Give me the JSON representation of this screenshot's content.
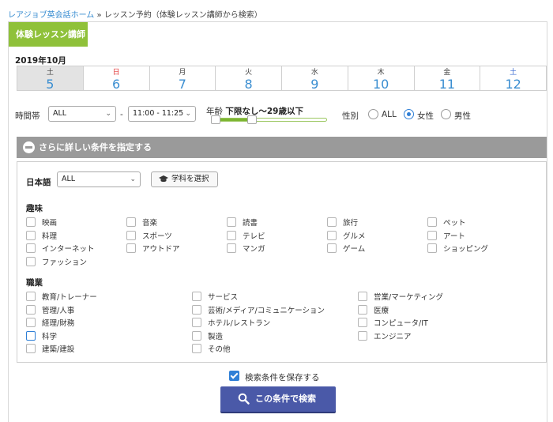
{
  "breadcrumb": {
    "home": "レアジョブ英会話ホーム",
    "sep": "»",
    "current": "レッスン予約（体験レッスン講師から検索）"
  },
  "tag": "体験レッスン講師",
  "month": "2019年10月",
  "days": [
    {
      "weekday": "土",
      "date": "5",
      "selected": true
    },
    {
      "weekday": "日",
      "date": "6"
    },
    {
      "weekday": "月",
      "date": "7"
    },
    {
      "weekday": "火",
      "date": "8"
    },
    {
      "weekday": "水",
      "date": "9"
    },
    {
      "weekday": "木",
      "date": "10"
    },
    {
      "weekday": "金",
      "date": "11"
    },
    {
      "weekday": "土",
      "date": "12"
    }
  ],
  "time": {
    "label": "時間帯",
    "from": "ALL",
    "dash": "-",
    "to": "11:00 - 11:25"
  },
  "age": {
    "label": "年齢",
    "value": "下限なし〜29歳以下",
    "range_fraction": [
      0,
      0.35
    ]
  },
  "gender": {
    "label": "性別",
    "options": [
      "ALL",
      "女性",
      "男性"
    ],
    "selected": "女性"
  },
  "filter_bar": "さらに詳しい条件を指定する",
  "japanese": {
    "label": "日本語",
    "value": "ALL"
  },
  "gakka_button": "学科を選択",
  "hobby": {
    "title": "趣味",
    "items": [
      "映画",
      "音楽",
      "読書",
      "旅行",
      "ペット",
      "料理",
      "スポーツ",
      "テレビ",
      "グルメ",
      "アート",
      "インターネット",
      "アウトドア",
      "マンガ",
      "ゲーム",
      "ショッピング",
      "ファッション"
    ]
  },
  "job": {
    "title": "職業",
    "items": [
      "教育/トレーナー",
      "サービス",
      "営業/マーケティング",
      "管理/人事",
      "芸術/メディア/コミュニケーション",
      "医療",
      "経理/財務",
      "ホテル/レストラン",
      "コンピュータ/IT",
      "科学",
      "製造",
      "エンジニア",
      "建築/建設",
      "その他"
    ]
  },
  "save_conditions": "検索条件を保存する",
  "search_button": "この条件で検索",
  "colors": {
    "green_tag": "#8fc13a",
    "link_blue": "#3a8ed1",
    "search_button": "#4a59a8",
    "filter_bar": "#9a9a9a"
  }
}
